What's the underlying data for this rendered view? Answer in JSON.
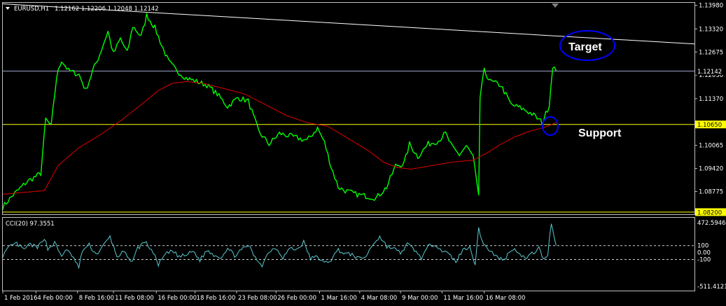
{
  "header": {
    "symbol_timeframe": "EURUSD,H1",
    "ohlc": "1.12162 1.12206 1.12048 1.12142"
  },
  "indicator": {
    "label": "CCI(20) 97.3551",
    "scale_labels": [
      "472.5946",
      "100",
      "0.00",
      "-100",
      "-511.4121"
    ]
  },
  "colors": {
    "background": "#000000",
    "price": "#00ff00",
    "ma": "#e00000",
    "support": "#ffff00",
    "hline": "#9aa2c8",
    "trendline": "#ffffff",
    "cci": "#5cc8d0",
    "ellipse": "#0000ff",
    "frame": "#c0c0c0"
  },
  "annotations": {
    "target": "Target",
    "support": "Support"
  },
  "chart_data": [
    {
      "type": "line",
      "y_ticks": [
        "1.13980",
        "1.13320",
        "1.12675",
        "1.12030",
        "1.11370",
        "1.10650",
        "1.10065",
        "1.09420",
        "1.08775",
        "1.08200"
      ],
      "price_tags": {
        "current": "1.12142",
        "support": "1.10650",
        "low": "1.08200"
      },
      "ylim": [
        1.0814,
        1.1405
      ],
      "levels": {
        "current": 1.12142,
        "support": 1.1065,
        "low": 1.082
      },
      "trendline": {
        "from": [
          0,
          1.1402
        ],
        "to": [
          100,
          1.129
        ]
      },
      "x_labels": [
        "1 Feb 2016",
        "4 Feb 00:00",
        "8 Feb 16:00",
        "11 Feb 08:00",
        "16 Feb 00:00",
        "18 Feb 16:00",
        "23 Feb 08:00",
        "26 Feb 00:00",
        "1 Mar 16:00",
        "4 Mar 08:00",
        "9 Mar 00:00",
        "11 Mar 16:00",
        "16 Mar 08:00"
      ],
      "series": [
        {
          "values": [
            [
              0,
              1.0835
            ],
            [
              1.5,
              1.0868
            ],
            [
              3.5,
              1.0905
            ],
            [
              5.5,
              1.0928
            ],
            [
              6.2,
              1.108
            ],
            [
              7.0,
              1.106
            ],
            [
              7.8,
              1.12
            ],
            [
              8.5,
              1.1245
            ],
            [
              9.5,
              1.1215
            ],
            [
              11.0,
              1.1205
            ],
            [
              12.0,
              1.116
            ],
            [
              13.0,
              1.1215
            ],
            [
              14.0,
              1.126
            ],
            [
              15.2,
              1.1325
            ],
            [
              16.0,
              1.1262
            ],
            [
              17.0,
              1.1305
            ],
            [
              18.0,
              1.1265
            ],
            [
              18.8,
              1.134
            ],
            [
              20.0,
              1.131
            ],
            [
              20.8,
              1.137
            ],
            [
              22.0,
              1.1335
            ],
            [
              23.0,
              1.1285
            ],
            [
              24.0,
              1.124
            ],
            [
              25.0,
              1.1218
            ],
            [
              26.5,
              1.1195
            ],
            [
              28.0,
              1.1185
            ],
            [
              29.5,
              1.1175
            ],
            [
              31.0,
              1.115
            ],
            [
              32.5,
              1.1115
            ],
            [
              34.0,
              1.114
            ],
            [
              35.5,
              1.113
            ],
            [
              37.0,
              1.1045
            ],
            [
              38.5,
              1.101
            ],
            [
              40.0,
              1.104
            ],
            [
              42.0,
              1.103
            ],
            [
              44.0,
              1.102
            ],
            [
              45.5,
              1.1055
            ],
            [
              46.5,
              1.1015
            ],
            [
              47.5,
              1.0945
            ],
            [
              48.5,
              1.089
            ],
            [
              49.5,
              1.088
            ],
            [
              51.0,
              1.087
            ],
            [
              52.5,
              1.0865
            ],
            [
              54.0,
              1.086
            ],
            [
              55.5,
              1.089
            ],
            [
              56.8,
              1.095
            ],
            [
              58.0,
              1.0955
            ],
            [
              58.8,
              1.101
            ],
            [
              60.0,
              1.0975
            ],
            [
              61.5,
              1.101
            ],
            [
              63.0,
              1.102
            ],
            [
              64.0,
              1.104
            ],
            [
              65.0,
              1.1
            ],
            [
              66.0,
              1.098
            ],
            [
              67.0,
              1.1005
            ],
            [
              68.0,
              1.0975
            ],
            [
              68.8,
              1.086
            ],
            [
              69.0,
              1.114
            ],
            [
              69.6,
              1.1215
            ],
            [
              70.5,
              1.1185
            ],
            [
              72.0,
              1.1175
            ],
            [
              73.5,
              1.112
            ],
            [
              75.0,
              1.111
            ],
            [
              76.5,
              1.1095
            ],
            [
              78.0,
              1.107
            ],
            [
              79.0,
              1.112
            ],
            [
              79.5,
              1.123
            ],
            [
              80.0,
              1.1215
            ]
          ]
        },
        {
          "values": [
            [
              0,
              1.087
            ],
            [
              6.0,
              1.088
            ],
            [
              8.0,
              1.095
            ],
            [
              11.0,
              1.1
            ],
            [
              14.0,
              1.1035
            ],
            [
              17.0,
              1.1075
            ],
            [
              20.0,
              1.112
            ],
            [
              22.5,
              1.116
            ],
            [
              24.5,
              1.118
            ],
            [
              26.5,
              1.1185
            ],
            [
              29.0,
              1.118
            ],
            [
              32.0,
              1.1165
            ],
            [
              35.0,
              1.115
            ],
            [
              38.0,
              1.112
            ],
            [
              41.0,
              1.109
            ],
            [
              44.0,
              1.107
            ],
            [
              47.0,
              1.106
            ],
            [
              50.0,
              1.1025
            ],
            [
              53.0,
              1.099
            ],
            [
              55.0,
              1.096
            ],
            [
              57.0,
              1.0945
            ],
            [
              59.0,
              1.094
            ],
            [
              62.0,
              1.095
            ],
            [
              65.0,
              1.096
            ],
            [
              68.0,
              1.0965
            ],
            [
              70.0,
              1.0985
            ],
            [
              72.0,
              1.101
            ],
            [
              74.0,
              1.103
            ],
            [
              76.0,
              1.1045
            ],
            [
              78.0,
              1.1055
            ],
            [
              80.0,
              1.107
            ]
          ]
        }
      ]
    },
    {
      "type": "line",
      "ylim": [
        -511.4121,
        472.5946
      ],
      "levels": [
        100,
        -100
      ],
      "series": [
        {
          "values": [
            [
              0,
              -40
            ],
            [
              1,
              80
            ],
            [
              2,
              130
            ],
            [
              3,
              40
            ],
            [
              4,
              120
            ],
            [
              5,
              60
            ],
            [
              6,
              220
            ],
            [
              6.5,
              50
            ],
            [
              7.5,
              140
            ],
            [
              8.5,
              -60
            ],
            [
              9,
              40
            ],
            [
              10,
              -40
            ],
            [
              11,
              -220
            ],
            [
              11.5,
              30
            ],
            [
              12.5,
              110
            ],
            [
              13.5,
              -30
            ],
            [
              14.5,
              90
            ],
            [
              15.5,
              230
            ],
            [
              16.5,
              -60
            ],
            [
              17.5,
              10
            ],
            [
              18.5,
              -150
            ],
            [
              19.5,
              60
            ],
            [
              20.5,
              160
            ],
            [
              21.5,
              40
            ],
            [
              22.5,
              -170
            ],
            [
              23.5,
              -30
            ],
            [
              24.5,
              20
            ],
            [
              25.5,
              -60
            ],
            [
              26.5,
              -40
            ],
            [
              27.5,
              20
            ],
            [
              28.5,
              -110
            ],
            [
              29.5,
              30
            ],
            [
              30.5,
              -30
            ],
            [
              31.5,
              -70
            ],
            [
              32.5,
              60
            ],
            [
              33.5,
              -40
            ],
            [
              34.5,
              30
            ],
            [
              35.5,
              110
            ],
            [
              36.5,
              -80
            ],
            [
              37.5,
              -180
            ],
            [
              38.5,
              20
            ],
            [
              39.5,
              70
            ],
            [
              40.5,
              -70
            ],
            [
              41.5,
              60
            ],
            [
              42.5,
              40
            ],
            [
              43.5,
              150
            ],
            [
              44.5,
              -90
            ],
            [
              45.5,
              -60
            ],
            [
              46.5,
              -160
            ],
            [
              47.5,
              -100
            ],
            [
              48.5,
              40
            ],
            [
              49.5,
              -20
            ],
            [
              50.5,
              -30
            ],
            [
              51.5,
              -90
            ],
            [
              52.5,
              -60
            ],
            [
              53.5,
              120
            ],
            [
              54.5,
              230
            ],
            [
              55.5,
              90
            ],
            [
              56.5,
              60
            ],
            [
              57.5,
              -10
            ],
            [
              58.5,
              120
            ],
            [
              59.5,
              40
            ],
            [
              60.5,
              -80
            ],
            [
              61.5,
              80
            ],
            [
              62.5,
              130
            ],
            [
              63.5,
              30
            ],
            [
              64.5,
              -30
            ],
            [
              65.5,
              -130
            ],
            [
              66.5,
              30
            ],
            [
              67.5,
              100
            ],
            [
              68.3,
              -180
            ],
            [
              68.8,
              350
            ],
            [
              69.5,
              120
            ],
            [
              70.5,
              20
            ],
            [
              71.5,
              -70
            ],
            [
              72.5,
              -110
            ],
            [
              73.5,
              50
            ],
            [
              74.5,
              20
            ],
            [
              75.5,
              -90
            ],
            [
              76.5,
              -20
            ],
            [
              77.5,
              60
            ],
            [
              78.2,
              -100
            ],
            [
              78.8,
              -20
            ],
            [
              79.3,
              440
            ],
            [
              80,
              100
            ]
          ]
        }
      ]
    }
  ]
}
